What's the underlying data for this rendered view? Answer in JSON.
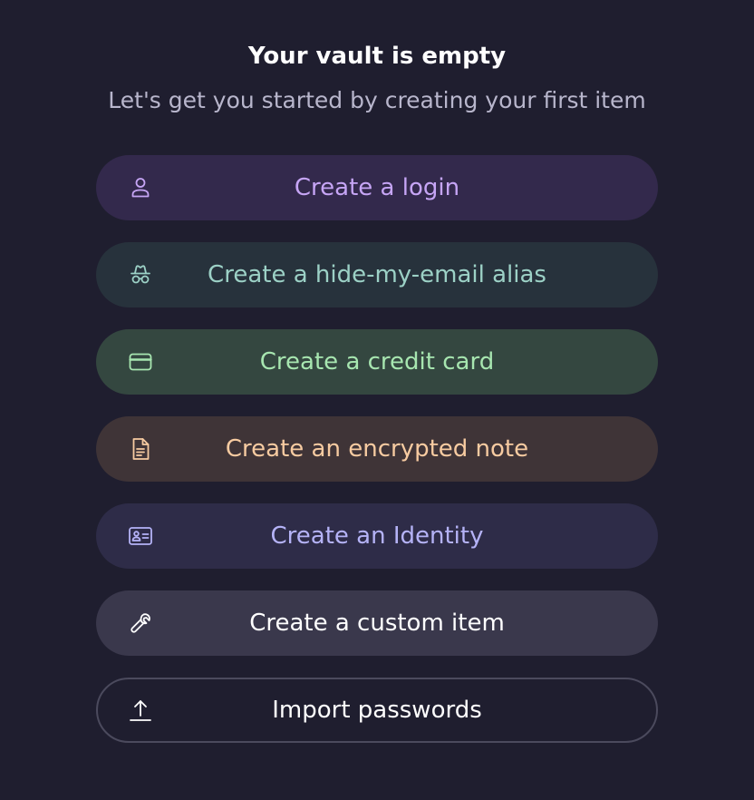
{
  "heading": {
    "title": "Your vault is empty",
    "subtitle": "Let's get you started by creating your first item"
  },
  "actions": {
    "login": {
      "label": "Create a login",
      "icon": "user-icon",
      "color": "#c6a5f5",
      "bg": "#33294c"
    },
    "alias": {
      "label": "Create a hide-my-email alias",
      "icon": "incognito-icon",
      "color": "#9cd1c6",
      "bg": "#27323c"
    },
    "credit_card": {
      "label": "Create a credit card",
      "icon": "credit-card-icon",
      "color": "#a7e6b0",
      "bg": "#344740"
    },
    "note": {
      "label": "Create an encrypted note",
      "icon": "note-icon",
      "color": "#f7cba1",
      "bg": "#3f3437"
    },
    "identity": {
      "label": "Create an Identity",
      "icon": "id-card-icon",
      "color": "#b5b3f7",
      "bg": "#2e2c48"
    },
    "custom": {
      "label": "Create a custom item",
      "icon": "wrench-icon",
      "color": "#ffffff",
      "bg": "#3a384c"
    },
    "import": {
      "label": "Import passwords",
      "icon": "upload-icon",
      "color": "#ffffff",
      "bg": "transparent"
    }
  },
  "theme": {
    "background": "#1f1e2f"
  }
}
